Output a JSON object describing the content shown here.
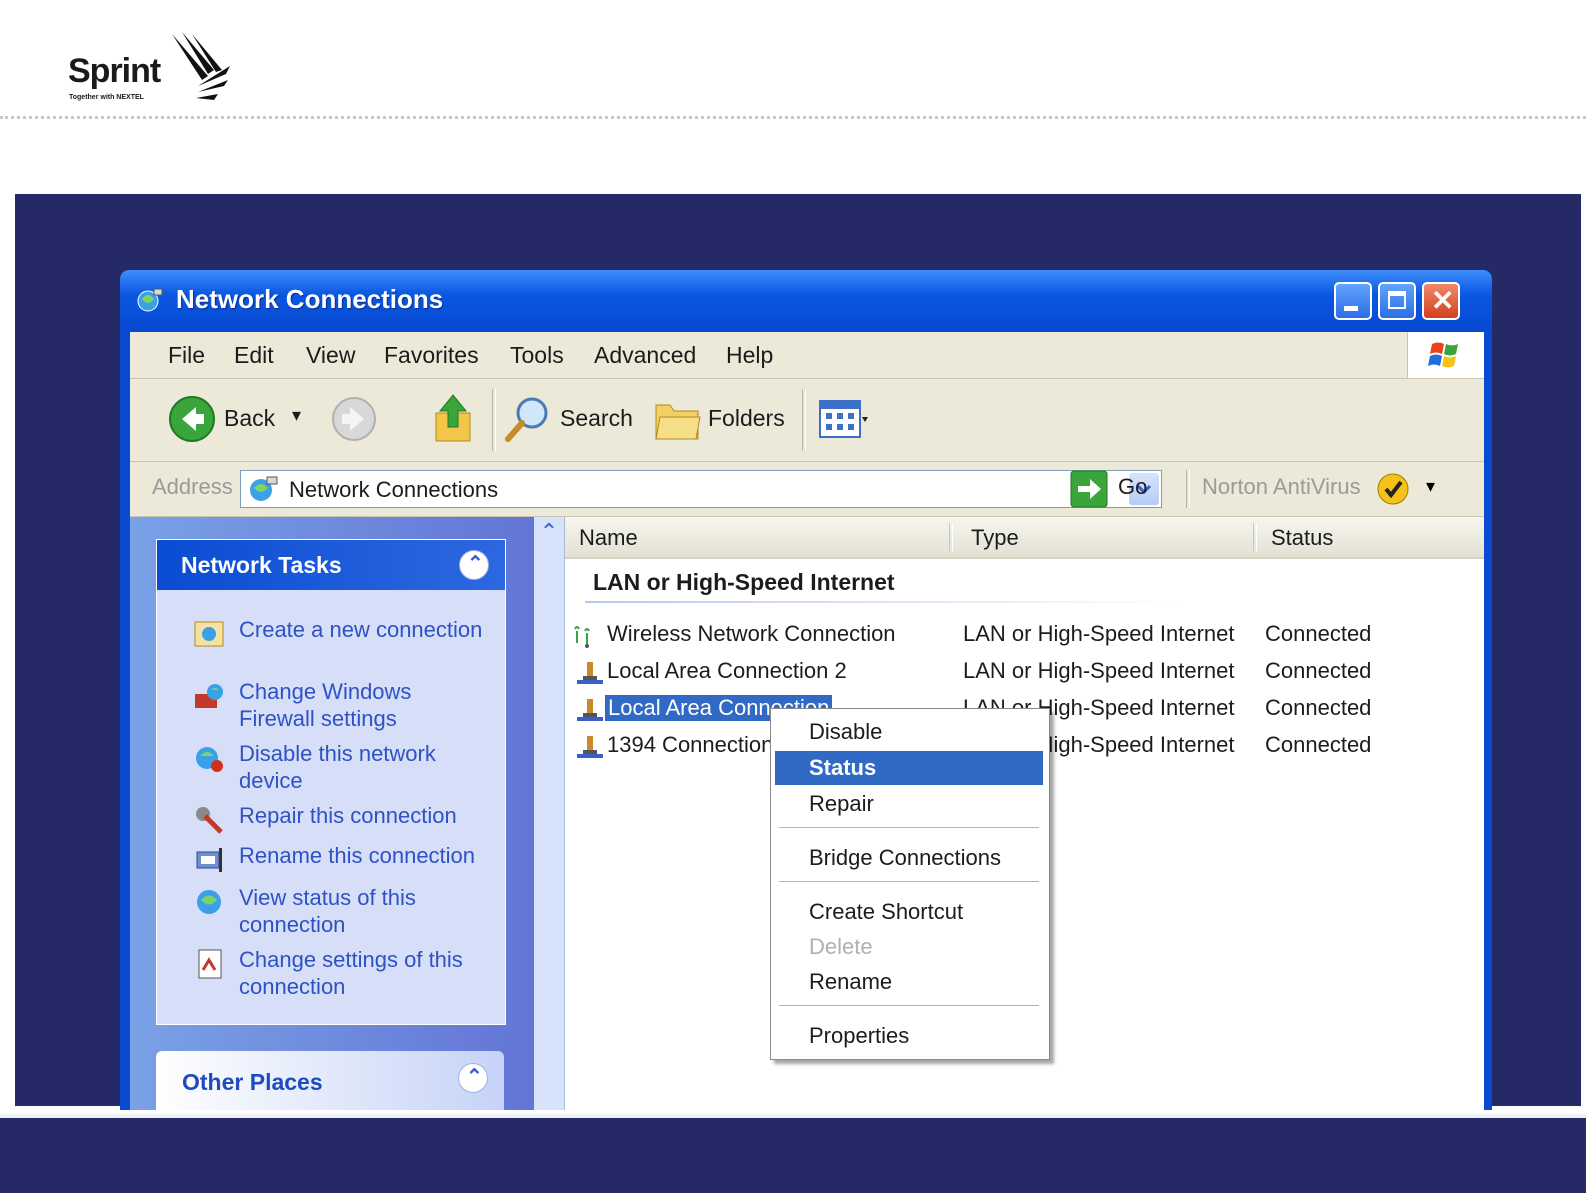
{
  "logo": {
    "brand": "Sprint",
    "tagline": "Together with NEXTEL"
  },
  "colors": {
    "slide_navy": "#252a66",
    "xp_blue": "#0a4ad0",
    "selection": "#316ac5",
    "link": "#2e52c6"
  },
  "window": {
    "title": "Network Connections",
    "menu": [
      "File",
      "Edit",
      "View",
      "Favorites",
      "Tools",
      "Advanced",
      "Help"
    ],
    "toolbar": {
      "back": "Back",
      "search": "Search",
      "folders": "Folders"
    },
    "address": {
      "label": "Address",
      "value": "Network Connections",
      "go": "Go",
      "norton": "Norton AntiVirus"
    }
  },
  "left_pane": {
    "network_tasks": {
      "title": "Network Tasks",
      "items": [
        {
          "icon": "new-connection-icon",
          "label": "Create a new connection"
        },
        {
          "icon": "firewall-icon",
          "label": "Change Windows Firewall settings"
        },
        {
          "icon": "disable-network-icon",
          "label": "Disable this network device"
        },
        {
          "icon": "repair-icon",
          "label": "Repair this connection"
        },
        {
          "icon": "rename-icon",
          "label": "Rename this connection"
        },
        {
          "icon": "status-icon",
          "label": "View status of this connection"
        },
        {
          "icon": "settings-icon",
          "label": "Change settings of this connection"
        }
      ]
    },
    "other_places": {
      "title": "Other Places"
    }
  },
  "list": {
    "columns": [
      "Name",
      "Type",
      "Status"
    ],
    "group": "LAN or High-Speed Internet",
    "rows": [
      {
        "icon": "wireless-connection-icon",
        "name": "Wireless Network Connection",
        "type": "LAN or High-Speed Internet",
        "status": "Connected"
      },
      {
        "icon": "lan-connection-icon",
        "name": "Local Area Connection 2",
        "type": "LAN or High-Speed Internet",
        "status": "Connected"
      },
      {
        "icon": "lan-connection-icon",
        "name": "Local Area Connection",
        "type": "LAN or High-Speed Internet",
        "status": "Connected"
      },
      {
        "icon": "lan-connection-icon",
        "name": "1394 Connection",
        "type": "LAN or High-Speed Internet",
        "status": "Connected"
      }
    ]
  },
  "context_menu": {
    "items": [
      "Disable",
      "Status",
      "Repair",
      "Bridge Connections",
      "Create Shortcut",
      "Delete",
      "Rename",
      "Properties"
    ],
    "highlighted": "Status",
    "disabled": [
      "Delete"
    ]
  }
}
